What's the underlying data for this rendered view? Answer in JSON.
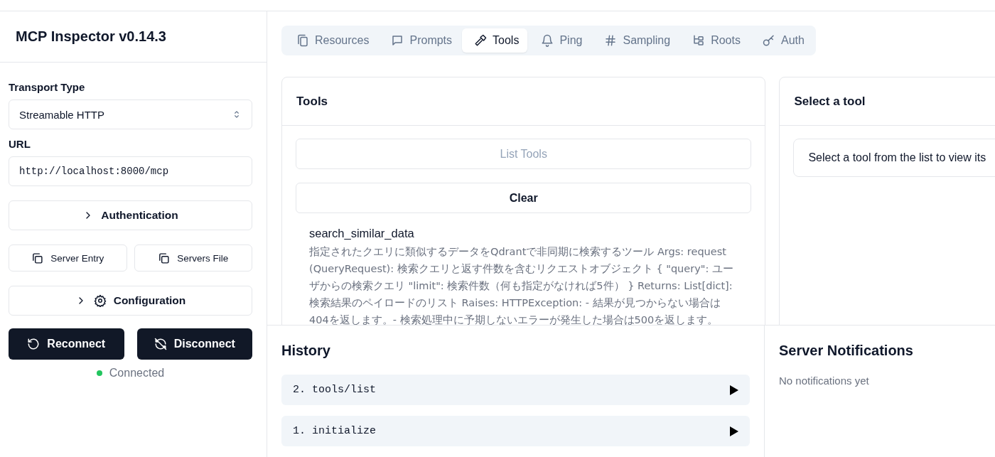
{
  "sidebar": {
    "title": "MCP Inspector v0.14.3",
    "transport": {
      "label": "Transport Type",
      "value": "Streamable HTTP"
    },
    "url": {
      "label": "URL",
      "value": "http://localhost:8000/mcp"
    },
    "authentication": {
      "label": "Authentication",
      "expanded": false
    },
    "copy_buttons": [
      "Server Entry",
      "Servers File"
    ],
    "configuration": {
      "label": "Configuration",
      "expanded": false
    },
    "actions": [
      {
        "kind": "reconnect",
        "label": "Reconnect"
      },
      {
        "kind": "disconnect",
        "label": "Disconnect"
      }
    ],
    "connection": {
      "connected": true,
      "label": "Connected"
    }
  },
  "tabs": [
    {
      "kind": "resources",
      "label": "Resources",
      "selected": false
    },
    {
      "kind": "prompts",
      "label": "Prompts",
      "selected": false
    },
    {
      "kind": "tools",
      "label": "Tools",
      "selected": true
    },
    {
      "kind": "ping",
      "label": "Ping",
      "selected": false
    },
    {
      "kind": "sampling",
      "label": "Sampling",
      "selected": false
    },
    {
      "kind": "roots",
      "label": "Roots",
      "selected": false
    },
    {
      "kind": "auth",
      "label": "Auth",
      "selected": false
    }
  ],
  "tools_panel": {
    "title": "Tools",
    "list_button": {
      "label": "List Tools",
      "disabled": true
    },
    "clear_button": "Clear",
    "tools": [
      {
        "name": "search_similar_data",
        "description": "指定されたクエリに類似するデータをQdrantで非同期に検索するツール Args: request (QueryRequest): 検索クエリと返す件数を含むリクエストオブジェクト { \"query\": ユーザからの検索クエリ \"limit\": 検索件数（何も指定がなければ5件） } Returns: List[dict]: 検索結果のペイロードのリスト Raises: HTTPException: - 結果が見つからない場合は404を返します。- 検索処理中に予期しないエラーが発生した場合は500を返します。"
      }
    ]
  },
  "detail_panel": {
    "title": "Select a tool",
    "message": "Select a tool from the list to view its"
  },
  "history": {
    "title": "History",
    "items": [
      {
        "label": "2. tools/list",
        "expanded": false
      },
      {
        "label": "1. initialize",
        "expanded": false
      }
    ]
  },
  "notifications": {
    "title": "Server Notifications",
    "empty": "No notifications yet"
  }
}
